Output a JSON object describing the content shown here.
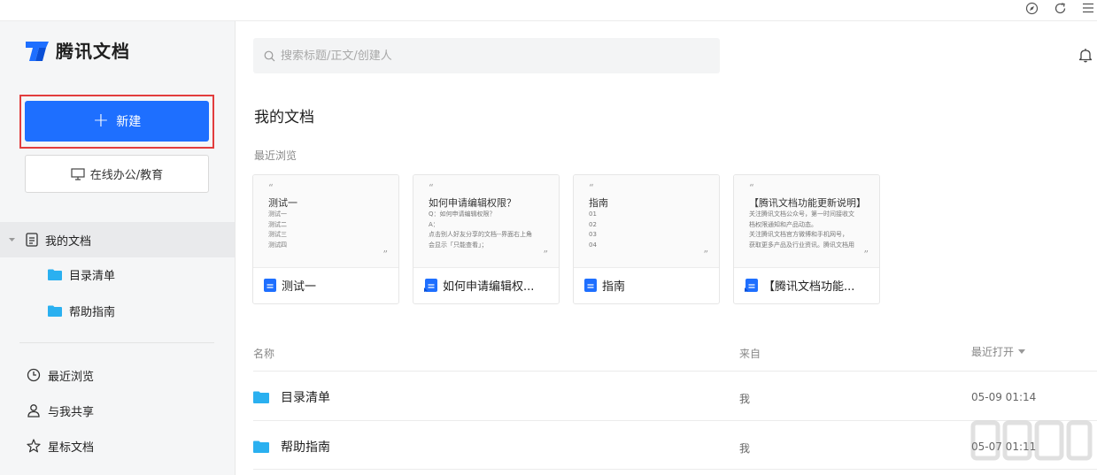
{
  "app": {
    "logo_text": "腾讯文档"
  },
  "sidebar": {
    "new_button": "新建",
    "office_button": "在线办公/教育",
    "my_docs": "我的文档",
    "folders": [
      "目录清单",
      "帮助指南"
    ],
    "recent": "最近浏览",
    "shared": "与我共享",
    "starred": "星标文档"
  },
  "search": {
    "placeholder": "搜索标题/正文/创建人"
  },
  "main": {
    "title": "我的文档",
    "recent_label": "最近浏览",
    "cards": [
      {
        "preview_title": "测试一",
        "preview_lines": [
          "测试一",
          "测试二",
          "测试三",
          "测试四"
        ],
        "name": "测试一",
        "icon": "doc-icon"
      },
      {
        "preview_title": "如何申请编辑权限？",
        "preview_lines": [
          "Q：如何申请编辑权限？",
          "A：",
          "点击别人好友分享的文档--界面右上角",
          "会显示「只能查看」；"
        ],
        "name": "如何申请编辑权...",
        "icon": "shared-doc-icon"
      },
      {
        "preview_title": "指南",
        "preview_lines": [
          "01",
          "02",
          "03",
          "04"
        ],
        "name": "指南",
        "icon": "doc-icon"
      },
      {
        "preview_title": "【腾讯文档功能更新说明】",
        "preview_lines": [
          "关注腾讯文档公众号，第一时间接收文",
          "档权限通知和产品动态。",
          "关注腾讯文档官方微博和手机网号，",
          "获取更多产品及行业资讯。腾讯文档用"
        ],
        "name": "【腾讯文档功能...",
        "icon": "shared-doc-icon"
      }
    ],
    "table": {
      "headers": {
        "name": "名称",
        "from": "来自",
        "opened": "最近打开"
      },
      "rows": [
        {
          "name": "目录清单",
          "from": "我",
          "opened": "05-09 01:14"
        },
        {
          "name": "帮助指南",
          "from": "我",
          "opened": "05-07 01:11"
        }
      ]
    }
  },
  "colors": {
    "accent": "#1e6fff",
    "highlight_border": "#e23d3d",
    "folder": "#2ab0f0"
  }
}
